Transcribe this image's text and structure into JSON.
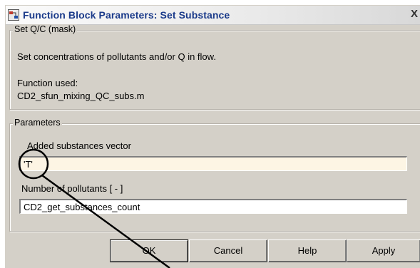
{
  "window": {
    "title": "Function Block Parameters: Set Substance",
    "close_label": "X",
    "title_icon": "simulink-block-icon"
  },
  "mask": {
    "legend": "Set Q/C (mask)",
    "description": "Set concentrations of pollutants and/or Q in flow.",
    "function_label": "Function used:",
    "function_name": "CD2_sfun_mixing_QC_subs.m"
  },
  "parameters": {
    "legend": "Parameters",
    "vector_label": "Added substances vector",
    "vector_value": "'T'",
    "count_label": "Number of pollutants [ - ]",
    "count_value": "CD2_get_substances_count"
  },
  "buttons": {
    "ok": "OK",
    "cancel": "Cancel",
    "help": "Help",
    "apply": "Apply"
  },
  "annotation": {
    "shape": "circle-with-pointer-line",
    "color": "#000000"
  }
}
